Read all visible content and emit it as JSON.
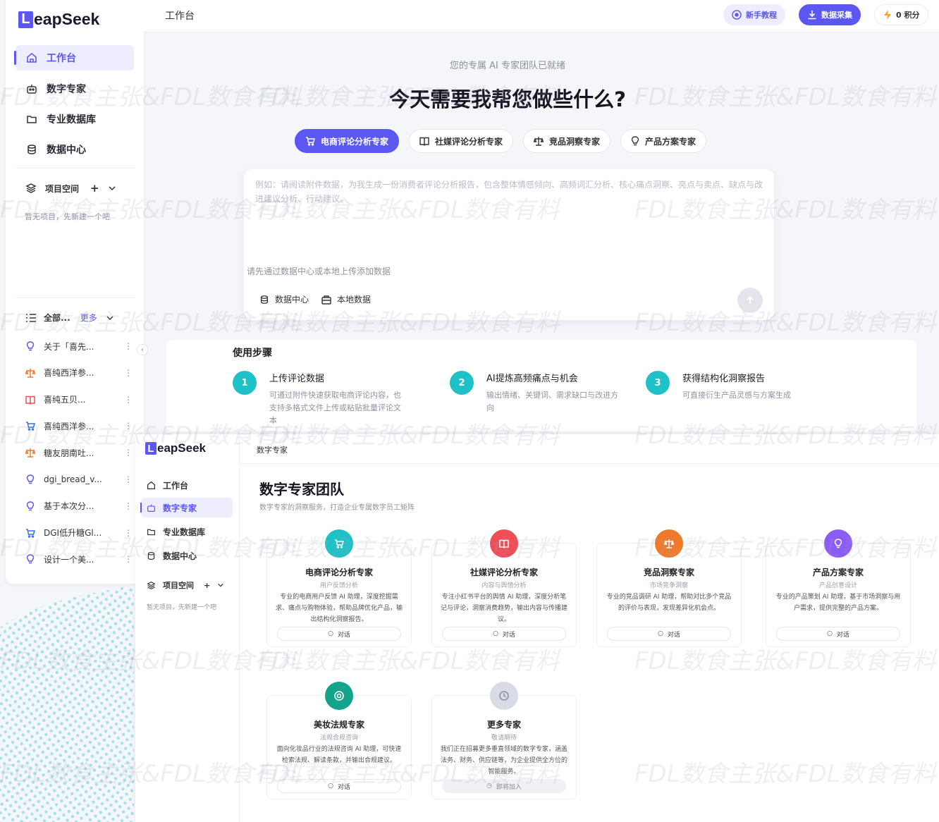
{
  "brand": {
    "mark": "L",
    "name": "eapSeek"
  },
  "sidebar": {
    "nav": [
      {
        "label": "工作台",
        "icon": "home-icon",
        "active": true
      },
      {
        "label": "数字专家",
        "icon": "robot-icon",
        "active": false
      },
      {
        "label": "专业数据库",
        "icon": "folder-icon",
        "active": false
      },
      {
        "label": "数据中心",
        "icon": "database-icon",
        "active": false
      }
    ],
    "project_space": {
      "label": "项目空间",
      "add": "+",
      "empty": "暂无项目，先新建一个吧"
    },
    "filter": {
      "label": "全部...",
      "more": "更多"
    },
    "chats": [
      {
        "title": "关于「喜先...",
        "icon": "bulb-icon",
        "color": "#5b57f0"
      },
      {
        "title": "喜纯西洋参...",
        "icon": "scale-icon",
        "color": "#f07a2c"
      },
      {
        "title": "喜纯五贝...",
        "icon": "book-icon",
        "color": "#ef4e57"
      },
      {
        "title": "喜纯西洋参...",
        "icon": "cart-icon",
        "color": "#3a6df0"
      },
      {
        "title": "糖友朋南吐...",
        "icon": "scale-icon",
        "color": "#f07a2c"
      },
      {
        "title": "dgi_bread_v...",
        "icon": "bulb-icon",
        "color": "#5b57f0"
      },
      {
        "title": "基于本次分...",
        "icon": "bulb-icon",
        "color": "#5b57f0"
      },
      {
        "title": "DGI低升糖Gl...",
        "icon": "cart-icon",
        "color": "#3a6df0"
      },
      {
        "title": "设计一个美...",
        "icon": "bulb-icon",
        "color": "#5b57f0"
      }
    ]
  },
  "topbar": {
    "breadcrumb": "工作台",
    "tutorial": "新手教程",
    "collect": "数据采集",
    "points": "0 积分"
  },
  "hero": {
    "subtitle": "您的专属 AI 专家团队已就绪",
    "title": "今天需要我帮您做些什么?"
  },
  "experts": [
    {
      "label": "电商评论分析专家",
      "icon": "cart-icon",
      "active": true
    },
    {
      "label": "社媒评论分析专家",
      "icon": "book-icon",
      "active": false
    },
    {
      "label": "竞品洞察专家",
      "icon": "scale-icon",
      "active": false
    },
    {
      "label": "产品方案专家",
      "icon": "bulb-icon",
      "active": false
    }
  ],
  "composer": {
    "placeholder": "例如：请阅读附件数据，为我生成一份消费者评论分析报告，包含整体情感倾向、高频词汇分析、核心痛点洞察、亮点与卖点、缺点与改进建议分析、行动建议。",
    "hint": "请先通过数据中心或本地上传添加数据",
    "source_center": "数据中心",
    "source_local": "本地数据"
  },
  "steps": {
    "title": "使用步骤",
    "items": [
      {
        "num": "1",
        "title": "上传评论数据",
        "desc": "可通过附件快速获取电商评论内容，也支持多格式文件上传或粘贴批量评论文本"
      },
      {
        "num": "2",
        "title": "AI提炼高频痛点与机会",
        "desc": "输出情绪、关键词、需求缺口与改进方向"
      },
      {
        "num": "3",
        "title": "获得结构化洞察报告",
        "desc": "可直接衍生产品灵感与方案生成"
      }
    ]
  },
  "inner": {
    "nav": [
      "工作台",
      "数字专家",
      "专业数据库",
      "数据中心"
    ],
    "project": "项目空间",
    "empty": "暂无项目，先新建一个吧",
    "breadcrumb": "数字专家",
    "title": "数字专家团队",
    "subtitle": "数字专家的洞察服务，打造企业专属数字员工矩阵",
    "cards": [
      {
        "name": "电商评论分析专家",
        "tag": "用户反馈分析",
        "desc": "专业的电商用户反馈 AI 助理，深度挖掘需求、痛点与购物体验，帮助品牌优化产品，输出结构化洞察报告。",
        "btn": "对话",
        "color": "#1ec1c7",
        "icon": "cart-icon"
      },
      {
        "name": "社媒评论分析专家",
        "tag": "内容与舆情分析",
        "desc": "专注小红书平台的舆情 AI 助理，深度分析笔记与评论，洞察消费趋势，输出内容与传播建议。",
        "btn": "对话",
        "color": "#ef4e57",
        "icon": "book-icon"
      },
      {
        "name": "竞品洞察专家",
        "tag": "市场竞争洞察",
        "desc": "专业的竞品调研 AI 助理，帮助对比多个竞品的评价与表现，发现差异化机会点。",
        "btn": "对话",
        "color": "#f07a2c",
        "icon": "scale-icon"
      },
      {
        "name": "产品方案专家",
        "tag": "产品创意设计",
        "desc": "专业的产品策划 AI 助理，基于市场洞察与用户需求，提供完整的产品方案。",
        "btn": "对话",
        "color": "#8b5cf6",
        "icon": "bulb-icon"
      },
      {
        "name": "美妆法规专家",
        "tag": "法规合规咨询",
        "desc": "面向化妆品行业的法规咨询 AI 助理，可快速检索法规、解读条款，并输出合规建议。",
        "btn": "对话",
        "color": "#14a38b",
        "icon": "target-icon"
      },
      {
        "name": "更多专家",
        "tag": "敬请期待",
        "desc": "我们正在招募更多垂直领域的数字专家，涵盖法务、财务、供应链等，为企业提供全方位的智能服务。",
        "btn": "即将加入",
        "color": "#d9dce6",
        "icon": "clock-icon"
      }
    ]
  },
  "watermark": "FDL数食主张&FDL数食有料"
}
